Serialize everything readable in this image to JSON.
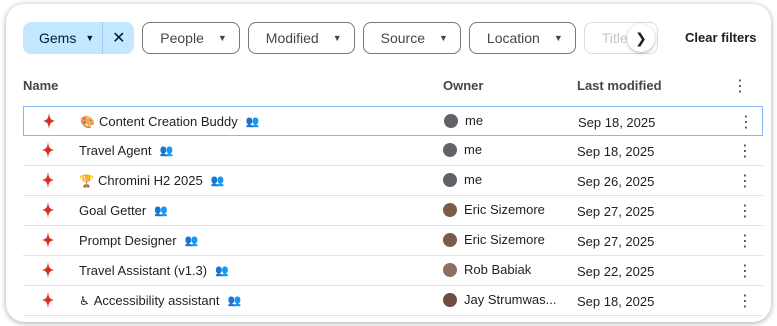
{
  "filters": {
    "gems": "Gems",
    "people": "People",
    "modified": "Modified",
    "source": "Source",
    "location": "Location",
    "title_only": "Title on",
    "clear": "Clear filters"
  },
  "columns": {
    "name": "Name",
    "owner": "Owner",
    "modified": "Last modified"
  },
  "colors": {
    "accent": "#c2e7ff",
    "gem_icon": "#d93025",
    "selected_border": "#8ab4f8"
  },
  "rows": [
    {
      "name": "Content Creation Buddy",
      "emoji": "🎨",
      "owner": "me",
      "modified": "Sep 18, 2025"
    },
    {
      "name": "Travel Agent",
      "emoji": "",
      "owner": "me",
      "modified": "Sep 18, 2025"
    },
    {
      "name": "Chromini H2 2025",
      "emoji": "🏆",
      "owner": "me",
      "modified": "Sep 26, 2025"
    },
    {
      "name": "Goal Getter",
      "emoji": "",
      "owner": "Eric Sizemore",
      "modified": "Sep 27, 2025"
    },
    {
      "name": "Prompt Designer",
      "emoji": "",
      "owner": "Eric Sizemore",
      "modified": "Sep 27, 2025"
    },
    {
      "name": "Travel Assistant (v1.3)",
      "emoji": "",
      "owner": "Rob Babiak",
      "modified": "Sep 22, 2025"
    },
    {
      "name": "Accessibility assistant",
      "emoji": "♿",
      "owner": "Jay Strumwas...",
      "modified": "Sep 18, 2025"
    }
  ]
}
